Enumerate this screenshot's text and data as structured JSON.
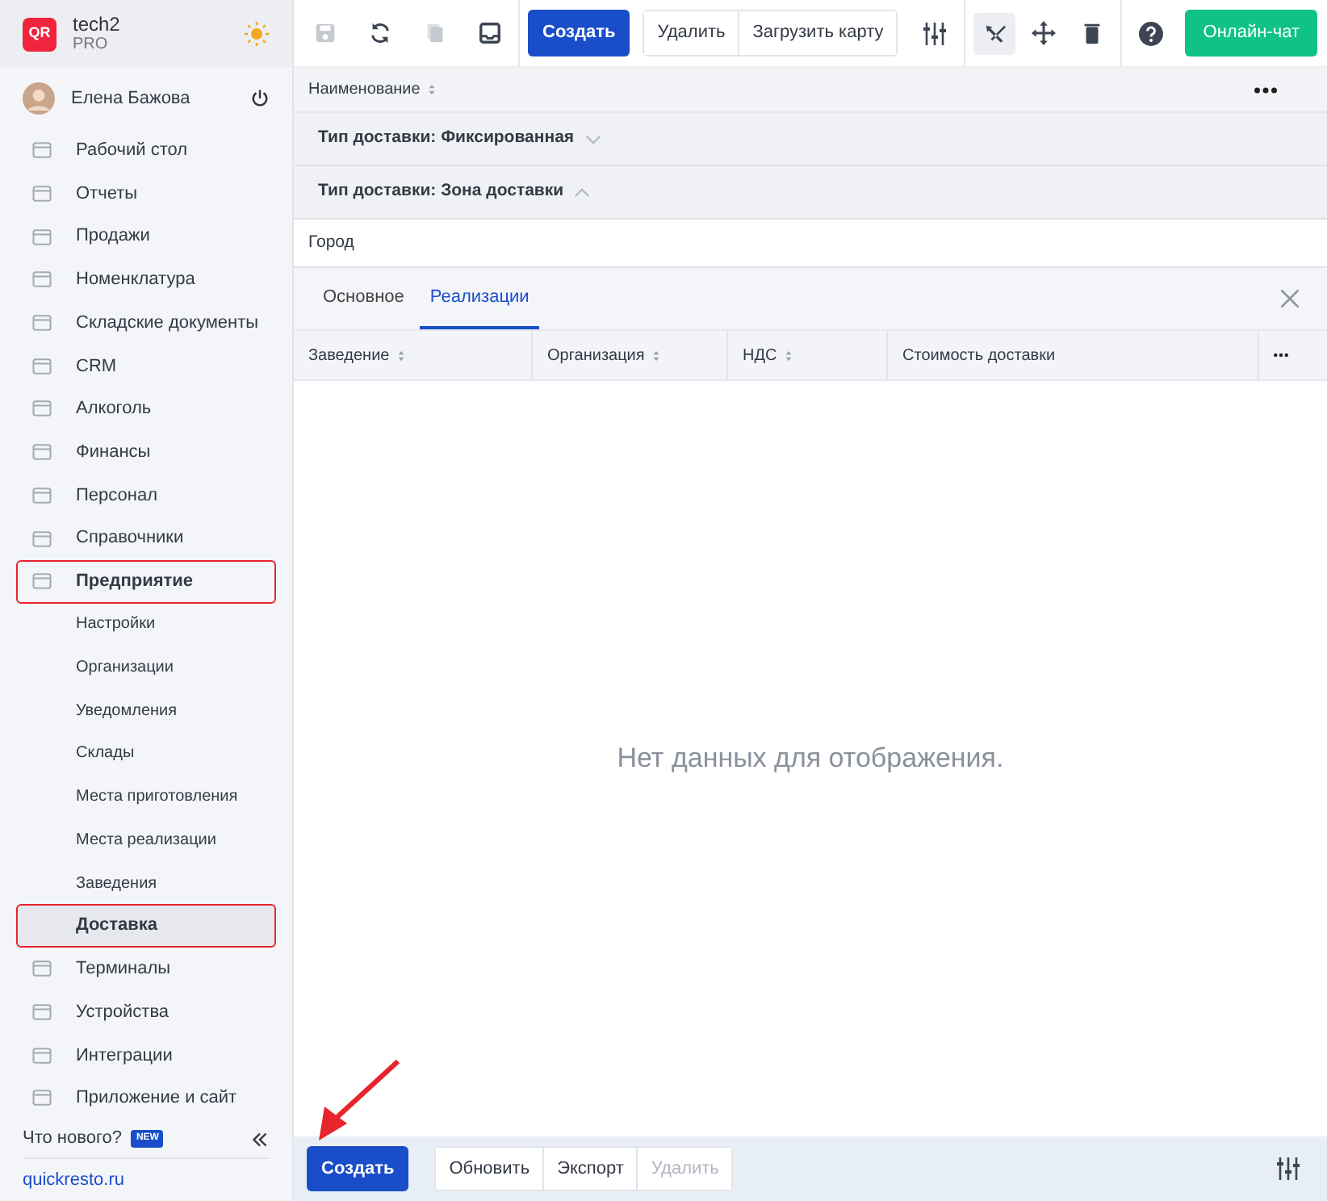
{
  "sidebar": {
    "brand": {
      "logo": "QR",
      "name": "tech2",
      "plan": "PRO"
    },
    "user": {
      "name": "Елена Бажова"
    },
    "items": [
      {
        "label": "Рабочий стол",
        "selected": false,
        "highlighted": false
      },
      {
        "label": "Отчеты",
        "selected": false,
        "highlighted": false
      },
      {
        "label": "Продажи",
        "selected": false,
        "highlighted": false
      },
      {
        "label": "Номенклатура",
        "selected": false,
        "highlighted": false
      },
      {
        "label": "Складские документы",
        "selected": false,
        "highlighted": false
      },
      {
        "label": "CRM",
        "selected": false,
        "highlighted": false
      },
      {
        "label": "Алкоголь",
        "selected": false,
        "highlighted": false
      },
      {
        "label": "Финансы",
        "selected": false,
        "highlighted": false
      },
      {
        "label": "Персонал",
        "selected": false,
        "highlighted": false
      },
      {
        "label": "Справочники",
        "selected": false,
        "highlighted": false
      },
      {
        "label": "Предприятие",
        "selected": false,
        "highlighted": true,
        "expanded": true,
        "children": [
          {
            "label": "Настройки",
            "selected": false,
            "highlighted": false
          },
          {
            "label": "Организации",
            "selected": false,
            "highlighted": false
          },
          {
            "label": "Уведомления",
            "selected": false,
            "highlighted": false
          },
          {
            "label": "Склады",
            "selected": false,
            "highlighted": false
          },
          {
            "label": "Места приготовления",
            "selected": false,
            "highlighted": false
          },
          {
            "label": "Места реализации",
            "selected": false,
            "highlighted": false
          },
          {
            "label": "Заведения",
            "selected": false,
            "highlighted": false
          },
          {
            "label": "Доставка",
            "selected": true,
            "highlighted": true
          }
        ]
      },
      {
        "label": "Терминалы",
        "selected": false,
        "highlighted": false
      },
      {
        "label": "Устройства",
        "selected": false,
        "highlighted": false
      },
      {
        "label": "Интеграции",
        "selected": false,
        "highlighted": false
      },
      {
        "label": "Приложение и сайт",
        "selected": false,
        "highlighted": false
      }
    ],
    "whats_new": {
      "label": "Что нового?",
      "badge": "NEW"
    },
    "site_link": "quickresto.ru"
  },
  "toolbar": {
    "icon_buttons": [
      {
        "kind": "save",
        "disabled": true
      },
      {
        "kind": "refresh",
        "disabled": false
      },
      {
        "kind": "copy",
        "disabled": true
      },
      {
        "kind": "inbox",
        "disabled": false
      }
    ],
    "create": "Создать",
    "group": [
      "Удалить",
      "Загрузить карту"
    ],
    "tools": [
      {
        "kind": "tools",
        "selected": true
      },
      {
        "kind": "move",
        "selected": false
      },
      {
        "kind": "trash",
        "selected": false
      }
    ],
    "chat": "Онлайн-чат"
  },
  "grid": {
    "columns": [
      {
        "label": "Наименование",
        "sortable": true
      }
    ],
    "groups": [
      {
        "label": "Тип доставки: Фиксированная",
        "expanded": false
      },
      {
        "label": "Тип доставки: Зона доставки",
        "expanded": true
      }
    ],
    "rows": [
      {
        "cells": [
          "Город"
        ]
      }
    ]
  },
  "detail": {
    "tabs": [
      {
        "label": "Основное",
        "selected": false
      },
      {
        "label": "Реализации",
        "selected": true
      }
    ],
    "columns": [
      {
        "label": "Заведение",
        "sortable": true
      },
      {
        "label": "Организация",
        "sortable": true
      },
      {
        "label": "НДС",
        "sortable": true
      },
      {
        "label": "Стоимость доставки",
        "sortable": false
      }
    ],
    "empty": "Нет данных для отображения."
  },
  "bottom_bar": {
    "buttons": [
      {
        "label": "Создать",
        "kind": "primary",
        "disabled": false
      },
      {
        "label": "Обновить",
        "kind": "plain",
        "disabled": false
      },
      {
        "label": "Экспорт",
        "kind": "plain",
        "disabled": false
      },
      {
        "label": "Удалить",
        "kind": "plain",
        "disabled": true
      }
    ]
  }
}
